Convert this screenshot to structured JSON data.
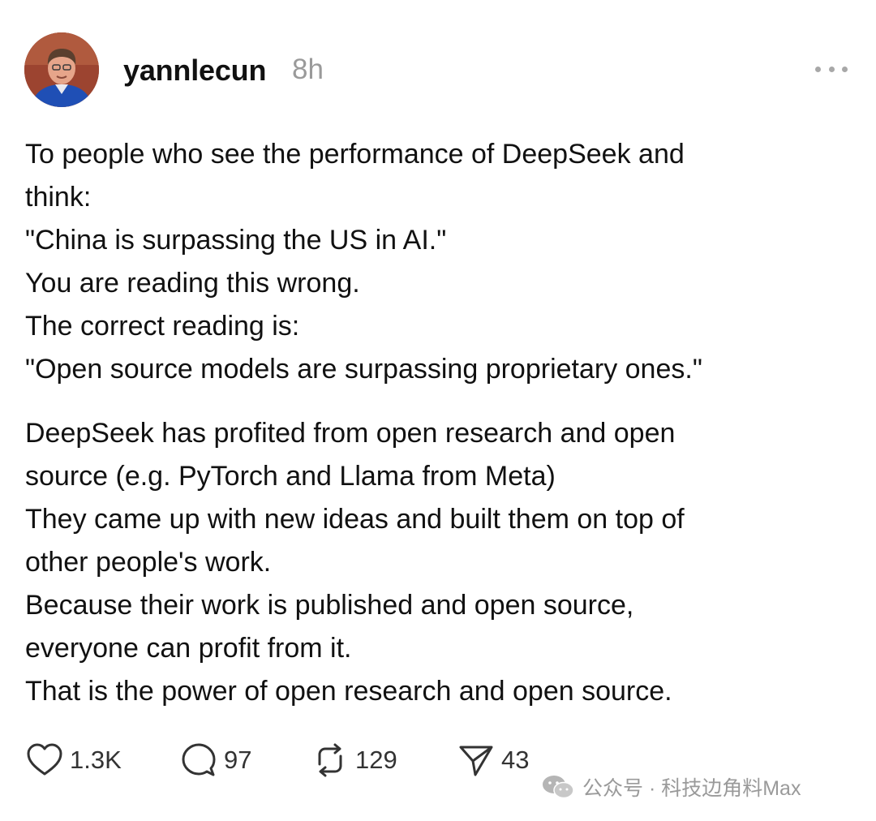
{
  "header": {
    "username": "yannlecun",
    "time": "8h",
    "avatar_icon": "user-avatar",
    "more_icon": "more-horizontal-icon"
  },
  "post": {
    "paragraph1": [
      "To people who see the performance of DeepSeek and",
      "think:",
      "\"China is surpassing the US in AI.\"",
      "You are reading this wrong.",
      "The correct reading is:",
      "\"Open source models are surpassing proprietary ones.\""
    ],
    "paragraph2": [
      "DeepSeek has profited from open research and open",
      "source (e.g. PyTorch and Llama from Meta)",
      "They came up with new ideas and built them on top of",
      "other people's work.",
      "Because their work is published and open source,",
      "everyone can profit from it.",
      "That is the power of open research and open source."
    ]
  },
  "actions": {
    "likes": "1.3K",
    "replies": "97",
    "reposts": "129",
    "shares": "43"
  },
  "watermark": {
    "text": "公众号 · 科技边角料Max"
  },
  "colors": {
    "text": "#111111",
    "muted": "#9a9a9a",
    "icon": "#333333"
  }
}
